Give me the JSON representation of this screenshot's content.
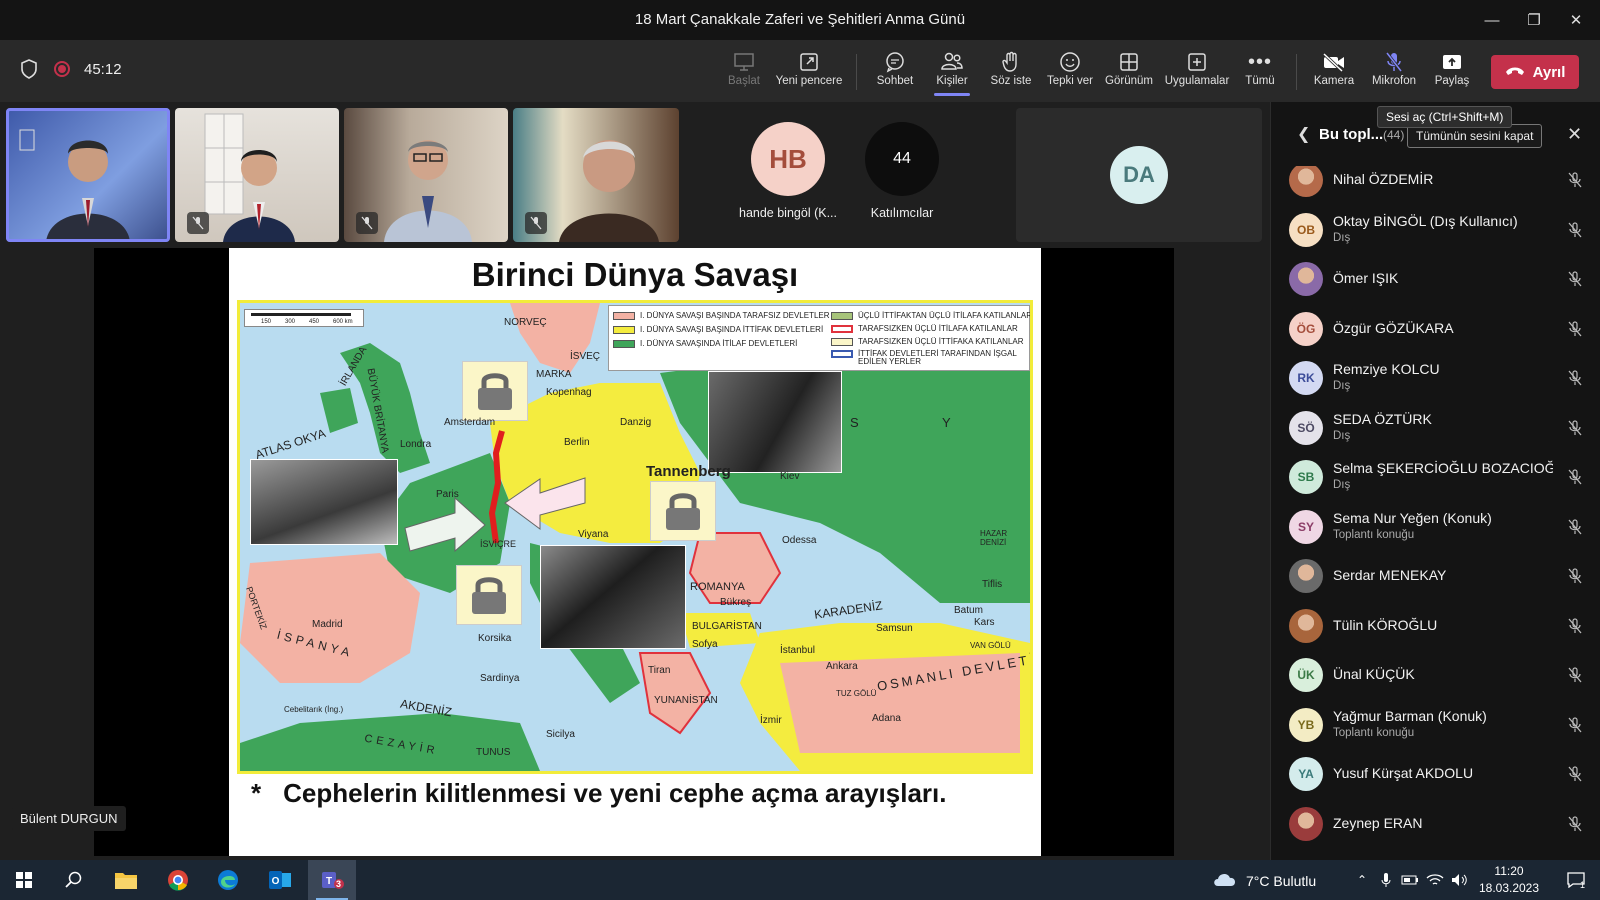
{
  "window": {
    "title": "18 Mart Çanakkale Zaferi ve Şehitleri Anma Günü"
  },
  "toolbar": {
    "timer": "45:12",
    "buttons": {
      "start": "Başlat",
      "new_window": "Yeni pencere",
      "chat": "Sohbet",
      "people": "Kişiler",
      "raise_hand": "Söz iste",
      "react": "Tepki ver",
      "view": "Görünüm",
      "apps": "Uygulamalar",
      "more": "Tümü",
      "camera": "Kamera",
      "mic": "Mikrofon",
      "share": "Paylaş"
    },
    "leave_label": "Ayrıl"
  },
  "gallery": {
    "hb": {
      "initials": "HB",
      "label": "hande bingöl (K...",
      "color": "#f5d1c8",
      "text_color": "#a44d3b"
    },
    "participants": {
      "count": "44",
      "label": "Katılımcılar"
    },
    "da": {
      "initials": "DA"
    }
  },
  "slide": {
    "title": "Birinci Dünya Savaşı",
    "subtitle": "Cephelerin kilitlenmesi ve yeni cephe açma arayışları.",
    "bullet": "*",
    "legend": [
      "I. DÜNYA SAVAŞI BAŞINDA TARAFSIZ DEVLETLER",
      "I. DÜNYA SAVAŞI BAŞINDA İTTİFAK DEVLETLERİ",
      "I. DÜNYA SAVAŞINDA İTİLAF DEVLETLERİ",
      "ÜÇLÜ İTTİFAKTAN ÜÇLÜ İTİLAFA KATILANLAR",
      "TARAFSIZKEN ÜÇLÜ İTİLAFA KATILANLAR",
      "TARAFSIZKEN ÜÇLÜ İTTİFAKA KATILANLAR",
      "İTTİFAK DEVLETLERİ TARAFINDAN İŞGAL EDİLEN YERLER"
    ],
    "scale": [
      "150",
      "300",
      "450",
      "600 km"
    ],
    "map_labels": {
      "tannenberg": "Tannenberg",
      "atlas": "ATLAS OKYA",
      "irlanda": "İRLANDA",
      "britanya": "BÜYÜK BRİTANYA",
      "londra": "Londra",
      "norvec": "NORVEÇ",
      "isvec": "İSVEÇ",
      "kopenhag": "Kopenhag",
      "danzig": "Danzig",
      "berlin": "Berlin",
      "amsterdam": "Amsterdam",
      "viyana": "Viyana",
      "kiev": "Kiev",
      "odessa": "Odessa",
      "romanya": "ROMANYA",
      "bukres": "Bükreş",
      "bulgaristan": "BULGARİSTAN",
      "sofya": "Sofya",
      "istanbul": "İstanbul",
      "karadeniz": "KARADENİZ",
      "samsun": "Samsun",
      "ankara": "Ankara",
      "osmanli": "OSMANLI DEVLETİ",
      "yunanistan": "YUNANİSTAN",
      "izmir": "İzmir",
      "adana": "Adana",
      "ispanya": "İSPANYA",
      "madrid": "Madrid",
      "portekiz": "PORTEKİZ",
      "akdeniz": "AKDENİZ",
      "cezayir": "CEZAYİR",
      "tunus": "TUNUS",
      "sicilya": "Sicilya",
      "korsika": "Korsika",
      "sardinya": "Sardinya",
      "isvicre": "İSVİÇRE",
      "hazar": "HAZAR DENİZİ",
      "tiflis": "Tiflis",
      "batum": "Batum",
      "kars": "Kars",
      "van": "VAN GÖLÜ",
      "tuz": "TUZ GÖLÜ",
      "cebelitarik": "Cebelitarık (İng.)",
      "paris": "Paris",
      "marka": "MARKA",
      "rusya": "S Y A",
      "tiran": "Tiran"
    }
  },
  "speaker": {
    "name": "Bülent DURGUN"
  },
  "panel": {
    "title": "Bu topl...",
    "count": "(44)",
    "mute_all": "Tümünün sesini kapat",
    "tooltip": "Sesi aç (Ctrl+Shift+M)",
    "participants": [
      {
        "initials": "",
        "photo": true,
        "photo_color": "#b56a4a",
        "name": "Nihal ÖZDEMİR",
        "sub": ""
      },
      {
        "initials": "OB",
        "name": "Oktay BİNGÖL (Dış Kullanıcı)",
        "sub": "Dış",
        "bg": "#f6dfc3",
        "fg": "#9a5a1c"
      },
      {
        "initials": "",
        "photo": true,
        "photo_color": "#8a6aa8",
        "name": "Ömer IŞIK",
        "sub": ""
      },
      {
        "initials": "ÖG",
        "name": "Özgür GÖZÜKARA",
        "sub": "",
        "bg": "#f5d1c8",
        "fg": "#a44d3b"
      },
      {
        "initials": "RK",
        "name": "Remziye KOLCU",
        "sub": "Dış",
        "bg": "#d3d9f2",
        "fg": "#3c4c99"
      },
      {
        "initials": "SÖ",
        "name": "SEDA ÖZTÜRK",
        "sub": "Dış",
        "bg": "#e4e2ea",
        "fg": "#4d4a63"
      },
      {
        "initials": "SB",
        "name": "Selma ŞEKERCİOĞLU BOZACIOĞ...",
        "sub": "Dış",
        "bg": "#cfeadb",
        "fg": "#2f7a4c"
      },
      {
        "initials": "SY",
        "name": "Sema Nur Yeğen (Konuk)",
        "sub": "Toplantı konuğu",
        "bg": "#efd7e4",
        "fg": "#8b3c66"
      },
      {
        "initials": "",
        "photo": true,
        "photo_color": "#6a6a6a",
        "name": "Serdar MENEKAY",
        "sub": ""
      },
      {
        "initials": "",
        "photo": true,
        "photo_color": "#a8653c",
        "name": "Tülin KÖROĞLU",
        "sub": ""
      },
      {
        "initials": "ÜK",
        "name": "Ünal KÜÇÜK",
        "sub": "",
        "bg": "#d9efdc",
        "fg": "#3b7a46"
      },
      {
        "initials": "YB",
        "name": "Yağmur Barman (Konuk)",
        "sub": "Toplantı konuğu",
        "bg": "#f3ecc4",
        "fg": "#7a6a1c"
      },
      {
        "initials": "YA",
        "name": "Yusuf Kürşat AKDOLU",
        "sub": "",
        "bg": "#d4ecec",
        "fg": "#3a7a7a"
      },
      {
        "initials": "",
        "photo": true,
        "photo_color": "#9a3c3c",
        "name": "Zeynep ERAN",
        "sub": ""
      }
    ]
  },
  "taskbar": {
    "weather": "7°C Bulutlu",
    "time": "11:20",
    "date": "18.03.2023",
    "teams_badge": "3",
    "notif_badge": "1"
  }
}
